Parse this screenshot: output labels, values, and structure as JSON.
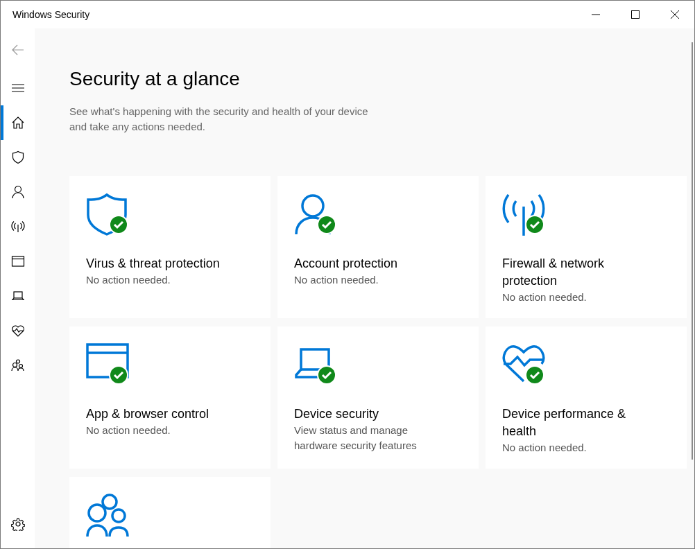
{
  "window": {
    "title": "Windows Security"
  },
  "nav": [
    {
      "kind": "back",
      "selected": false
    },
    {
      "kind": "menu",
      "selected": false
    },
    {
      "kind": "home",
      "selected": true
    },
    {
      "kind": "shield",
      "selected": false
    },
    {
      "kind": "person",
      "selected": false
    },
    {
      "kind": "antenna",
      "selected": false
    },
    {
      "kind": "browser",
      "selected": false
    },
    {
      "kind": "laptop",
      "selected": false
    },
    {
      "kind": "heart",
      "selected": false
    },
    {
      "kind": "family",
      "selected": false
    }
  ],
  "settings": {
    "kind": "gear"
  },
  "page": {
    "title": "Security at a glance",
    "subtitle": "See what's happening with the security and health of your device\nand take any actions needed."
  },
  "cards": [
    {
      "kind": "shield",
      "ok": true,
      "title": "Virus & threat protection",
      "status": "No action needed."
    },
    {
      "kind": "person",
      "ok": true,
      "title": "Account protection",
      "status": "No action needed."
    },
    {
      "kind": "antenna",
      "ok": true,
      "title": "Firewall & network\nprotection",
      "status": "No action needed."
    },
    {
      "kind": "browser",
      "ok": true,
      "title": "App & browser control",
      "status": "No action needed."
    },
    {
      "kind": "laptop",
      "ok": true,
      "title": "Device security",
      "status": "View status and manage\nhardware security features"
    },
    {
      "kind": "heart",
      "ok": true,
      "title": "Device performance &\nhealth",
      "status": "No action needed."
    },
    {
      "kind": "family"
    }
  ]
}
